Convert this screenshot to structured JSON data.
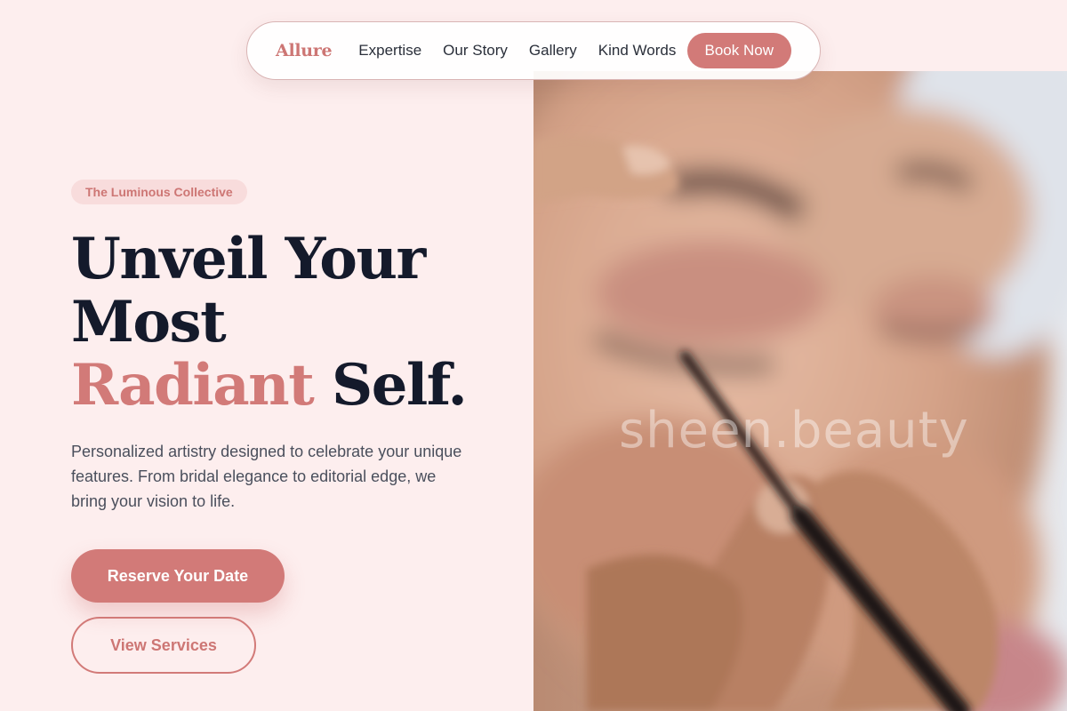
{
  "nav": {
    "brand": "Allure",
    "links": [
      "Expertise",
      "Our Story",
      "Gallery",
      "Kind Words"
    ],
    "cta_label": "Book Now"
  },
  "hero": {
    "badge": "The Luminous Collective",
    "headline_line1": "Unveil Your",
    "headline_line2": "Most",
    "headline_accent": "Radiant",
    "headline_end": " Self.",
    "subtext": "Personalized artistry designed to celebrate your unique features. From bridal elegance to editorial edge, we bring your vision to life.",
    "primary_cta": "Reserve Your Date",
    "secondary_cta": "View Services",
    "image_watermark": "sheen.beauty"
  },
  "colors": {
    "background": "#fdeeee",
    "accent": "#d27a78",
    "heading": "#141a2b",
    "body_text": "#4a4f5c",
    "badge_bg": "#f8dcdc"
  },
  "icons": {
    "hero_image": "makeup-eyeliner-photo"
  }
}
